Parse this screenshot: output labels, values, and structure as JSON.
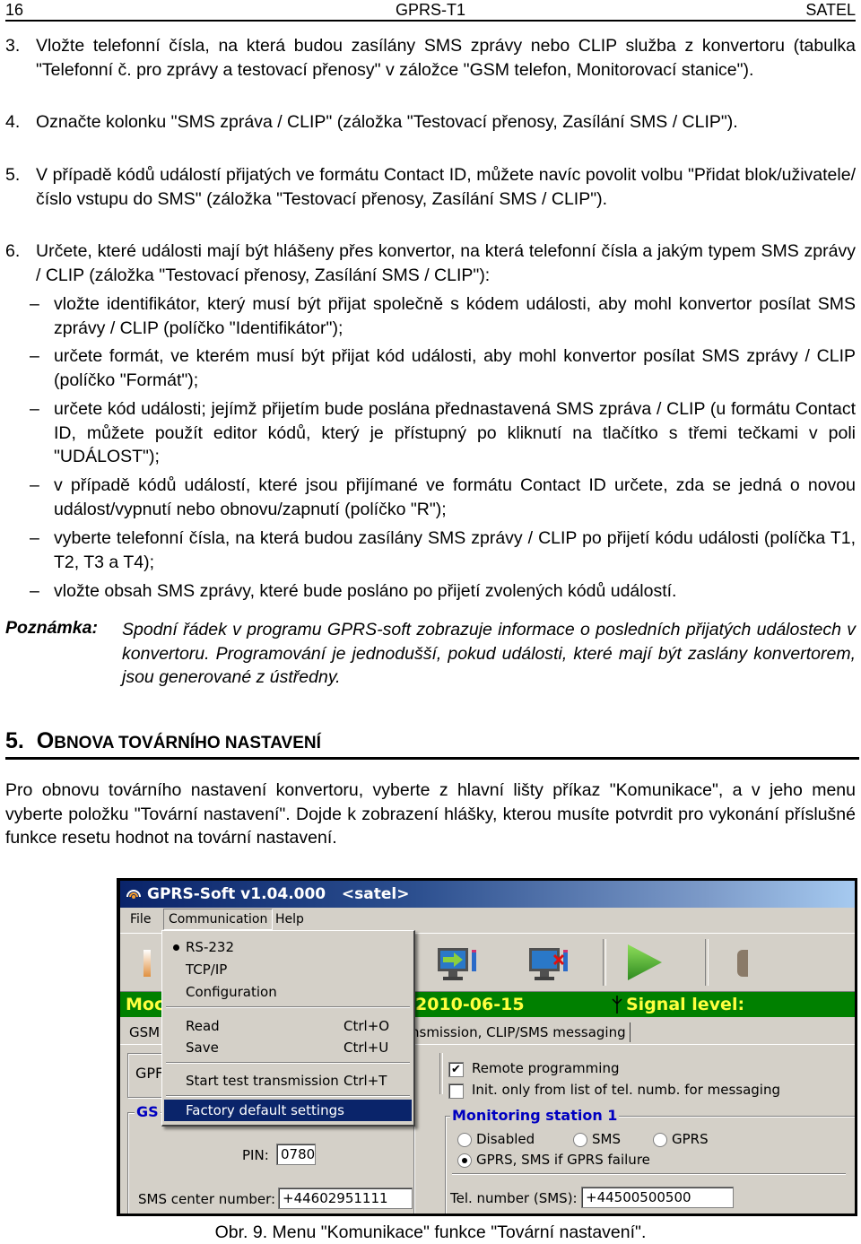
{
  "header": {
    "page_number": "16",
    "doc_title": "GPRS-T1",
    "brand": "SATEL"
  },
  "steps": [
    {
      "num": "3.",
      "text": "Vložte telefonní čísla, na která budou zasílány SMS zprávy nebo CLIP služba z konvertoru (tabulka \"Telefonní č. pro zprávy a testovací přenosy\" v záložce \"GSM telefon, Monitorovací stanice\")."
    },
    {
      "num": "4.",
      "text": "Označte kolonku \"SMS zpráva / CLIP\" (záložka \"Testovací přenosy, Zasílání SMS / CLIP\")."
    },
    {
      "num": "5.",
      "text": "V případě kódů událostí přijatých ve formátu Contact ID, můžete navíc povolit volbu \"Přidat blok/uživatele/číslo vstupu do SMS\" (záložka \"Testovací přenosy, Zasílání SMS / CLIP\")."
    },
    {
      "num": "6.",
      "text": "Určete, které události mají být hlášeny přes konvertor, na která telefonní čísla a jakým typem SMS zprávy / CLIP (záložka \"Testovací přenosy, Zasílání SMS / CLIP\"):"
    }
  ],
  "sub_items": [
    "vložte identifikátor, který musí být přijat společně s kódem události, aby mohl konvertor posílat SMS zprávy / CLIP (políčko \"Identifikátor\");",
    "určete formát, ve kterém musí být přijat kód události, aby mohl konvertor posílat SMS zprávy / CLIP (políčko \"Formát\");",
    "určete kód události; jejímž přijetím bude poslána přednastavená SMS zpráva / CLIP (u formátu Contact ID, můžete použít editor kódů, který je přístupný po kliknutí na tlačítko s třemi tečkami v poli \"UDÁLOST\");",
    "v případě kódů událostí, které jsou přijímané ve formátu Contact ID určete, zda se jedná o novou událost/vypnutí nebo obnovu/zapnutí (políčko \"R\");",
    "vyberte telefonní čísla, na která budou zasílány SMS zprávy / CLIP po přijetí kódu události (políčka T1, T2, T3 a T4);",
    "vložte obsah SMS zprávy, které bude posláno po přijetí zvolených kódů událostí."
  ],
  "dash": "–",
  "note": {
    "label": "Poznámka:",
    "text": "Spodní řádek v programu GPRS-soft zobrazuje informace o posledních přijatých událostech v konvertoru. Programování je jednodušší, pokud události, které mají být zaslány konvertorem, jsou generované z ústředny."
  },
  "section": {
    "number": "5.",
    "first_letter": "O",
    "rest_upper": "BNOVA TOVÁRNÍHO NASTAVENÍ"
  },
  "paragraph": "Pro obnovu továrního nastavení konvertoru, vyberte z hlavní lišty příkaz \"Komunikace\", a v jeho menu vyberte položku \"Tovární nastavení\". Dojde k zobrazení hlášky, kterou musíte potvrdit pro vykonání příslušné funkce resetu hodnot na tovární nastavení.",
  "screenshot": {
    "window_title": "GPRS-Soft v1.04.000   <satel>",
    "menubar": {
      "file": "File",
      "communication": "Communication",
      "help": "Help"
    },
    "menu_items": [
      {
        "label": "RS-232",
        "shortcut": "",
        "checked": true
      },
      {
        "label": "TCP/IP",
        "shortcut": ""
      },
      {
        "label": "Configuration",
        "shortcut": ""
      },
      {
        "label": "Read",
        "shortcut": "Ctrl+O"
      },
      {
        "label": "Save",
        "shortcut": "Ctrl+U"
      },
      {
        "label": "Start test transmission",
        "shortcut": "Ctrl+T"
      },
      {
        "label": "Factory default settings",
        "shortcut": "",
        "selected": true
      }
    ],
    "status": {
      "left_partial": "Moc",
      "date": "2010-06-15",
      "signal": "Signal level:"
    },
    "tabs": {
      "tab1_partial": "GSM",
      "tab2_partial": "nsmission, CLIP/SMS messaging"
    },
    "left_labels": {
      "gprs_partial": "GPF",
      "gsm_group_partial": "GS"
    },
    "pin_label": "PIN:",
    "pin_value": "0780",
    "sms_center_label": "SMS center number:",
    "sms_center_value": "+44602951111",
    "remote_programming": {
      "label": "Remote programming",
      "checked": true
    },
    "init_only": {
      "label": "Init. only from list of tel. numb. for messaging",
      "checked": false
    },
    "monitoring_station": {
      "title": "Monitoring station 1",
      "options": [
        "Disabled",
        "SMS",
        "GPRS",
        "GPRS, SMS if GPRS failure"
      ],
      "selected": "GPRS, SMS if GPRS failure"
    },
    "tel_number_label": "Tel. number (SMS):",
    "tel_number_value": "+44500500500",
    "colors": {
      "title_bar": "#0a246a",
      "status_bar": "#008000",
      "status_text": "#ffff40",
      "selection": "#0a246a",
      "group_title": "#0000c0"
    }
  },
  "caption": "Obr. 9. Menu \"Komunikace\" funkce \"Tovární nastavení\"."
}
